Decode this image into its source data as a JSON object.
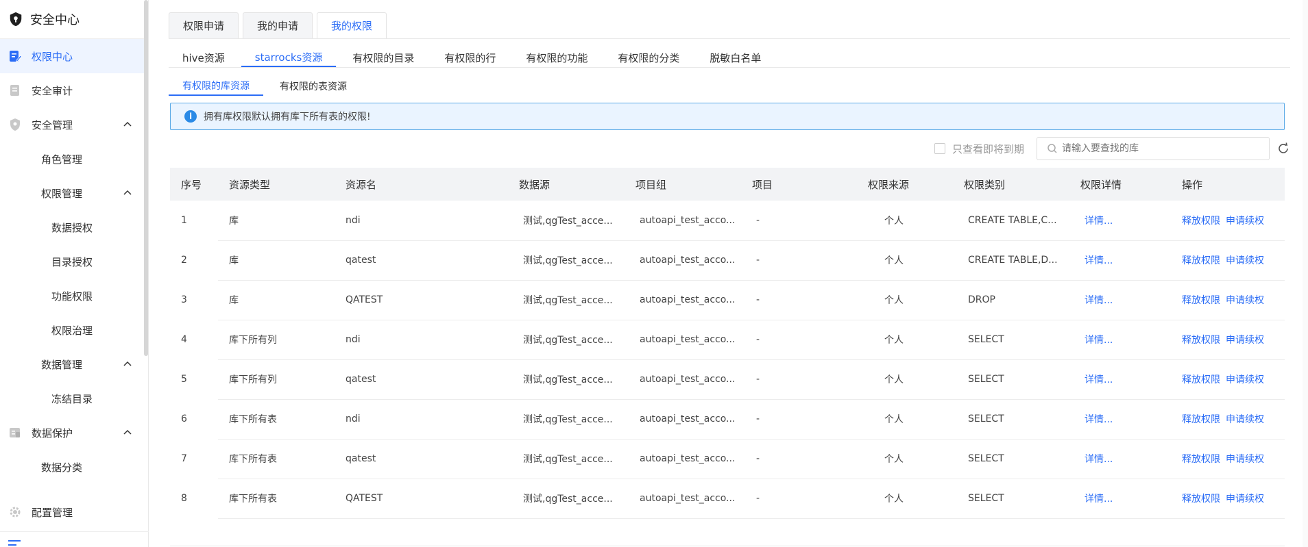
{
  "sidebar": {
    "title": "安全中心",
    "items": [
      {
        "label": "权限中心",
        "level": 1,
        "active": true
      },
      {
        "label": "安全审计",
        "level": 1
      },
      {
        "label": "安全管理",
        "level": 1,
        "expanded": true
      },
      {
        "label": "角色管理",
        "level": 2
      },
      {
        "label": "权限管理",
        "level": 2,
        "expanded": true
      },
      {
        "label": "数据授权",
        "level": 3
      },
      {
        "label": "目录授权",
        "level": 3
      },
      {
        "label": "功能权限",
        "level": 3
      },
      {
        "label": "权限治理",
        "level": 3
      },
      {
        "label": "数据管理",
        "level": 2,
        "expanded": true
      },
      {
        "label": "冻结目录",
        "level": 3
      },
      {
        "label": "数据保护",
        "level": 1,
        "expanded": true
      },
      {
        "label": "数据分类",
        "level": 2
      },
      {
        "label": "配置管理",
        "level": 1
      }
    ]
  },
  "top_tabs": [
    {
      "label": "权限申请"
    },
    {
      "label": "我的申请"
    },
    {
      "label": "我的权限",
      "active": true
    }
  ],
  "sub_tabs": [
    {
      "label": "hive资源"
    },
    {
      "label": "starrocks资源",
      "active": true
    },
    {
      "label": "有权限的目录"
    },
    {
      "label": "有权限的行"
    },
    {
      "label": "有权限的功能"
    },
    {
      "label": "有权限的分类"
    },
    {
      "label": "脱敏白名单"
    }
  ],
  "third_tabs": [
    {
      "label": "有权限的库资源",
      "active": true
    },
    {
      "label": "有权限的表资源"
    }
  ],
  "notice": {
    "icon": "info-icon",
    "text": "拥有库权限默认拥有库下所有表的权限!"
  },
  "filter": {
    "checkbox_label": "只查看即将到期",
    "search_placeholder": "请输入要查找的库"
  },
  "table": {
    "columns": [
      "序号",
      "资源类型",
      "资源名",
      "数据源",
      "项目组",
      "项目",
      "权限来源",
      "权限类别",
      "权限详情",
      "操作"
    ],
    "rows": [
      {
        "idx": "1",
        "type": "库",
        "name": "ndi",
        "source": "测试,qgTest_acce...",
        "group": "autoapi_test_acco...",
        "project": "-",
        "origin": "个人",
        "category": "CREATE TABLE,C...",
        "detail": "详情...",
        "release": "释放权限",
        "renew": "申请续权"
      },
      {
        "idx": "2",
        "type": "库",
        "name": "qatest",
        "source": "测试,qgTest_acce...",
        "group": "autoapi_test_acco...",
        "project": "-",
        "origin": "个人",
        "category": "CREATE TABLE,D...",
        "detail": "详情...",
        "release": "释放权限",
        "renew": "申请续权"
      },
      {
        "idx": "3",
        "type": "库",
        "name": "QATEST",
        "source": "测试,qgTest_acce...",
        "group": "autoapi_test_acco...",
        "project": "-",
        "origin": "个人",
        "category": "DROP",
        "detail": "详情...",
        "release": "释放权限",
        "renew": "申请续权"
      },
      {
        "idx": "4",
        "type": "库下所有列",
        "name": "ndi",
        "source": "测试,qgTest_acce...",
        "group": "autoapi_test_acco...",
        "project": "-",
        "origin": "个人",
        "category": "SELECT",
        "detail": "详情...",
        "release": "释放权限",
        "renew": "申请续权"
      },
      {
        "idx": "5",
        "type": "库下所有列",
        "name": "qatest",
        "source": "测试,qgTest_acce...",
        "group": "autoapi_test_acco...",
        "project": "-",
        "origin": "个人",
        "category": "SELECT",
        "detail": "详情...",
        "release": "释放权限",
        "renew": "申请续权"
      },
      {
        "idx": "6",
        "type": "库下所有表",
        "name": "ndi",
        "source": "测试,qgTest_acce...",
        "group": "autoapi_test_acco...",
        "project": "-",
        "origin": "个人",
        "category": "SELECT",
        "detail": "详情...",
        "release": "释放权限",
        "renew": "申请续权"
      },
      {
        "idx": "7",
        "type": "库下所有表",
        "name": "qatest",
        "source": "测试,qgTest_acce...",
        "group": "autoapi_test_acco...",
        "project": "-",
        "origin": "个人",
        "category": "SELECT",
        "detail": "详情...",
        "release": "释放权限",
        "renew": "申请续权"
      },
      {
        "idx": "8",
        "type": "库下所有表",
        "name": "QATEST",
        "source": "测试,qgTest_acce...",
        "group": "autoapi_test_acco...",
        "project": "-",
        "origin": "个人",
        "category": "SELECT",
        "detail": "详情...",
        "release": "释放权限",
        "renew": "申请续权"
      }
    ]
  },
  "colors": {
    "accent": "#2a6cf6",
    "notice_bg": "#eaf4ff",
    "notice_border": "#58a8e6",
    "header_bg": "#f2f3f5"
  }
}
